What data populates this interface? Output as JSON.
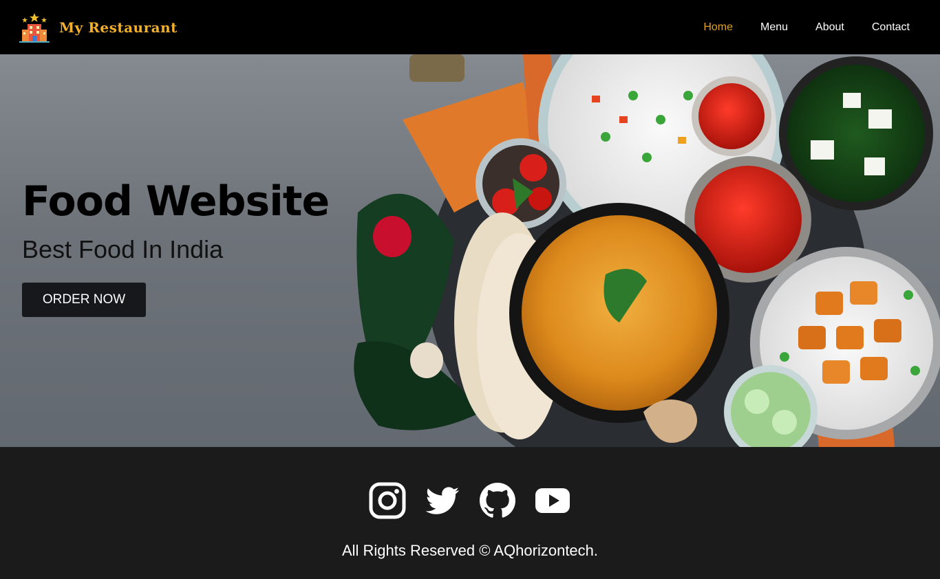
{
  "brand": {
    "name": "My Restaurant",
    "icon": "hotel-building-icon",
    "color": "#f2b02d"
  },
  "nav": {
    "accent": "#e0a020",
    "items": [
      {
        "label": "Home",
        "active": true
      },
      {
        "label": "Menu",
        "active": false
      },
      {
        "label": "About",
        "active": false
      },
      {
        "label": "Contact",
        "active": false
      }
    ]
  },
  "hero": {
    "title": "Food Website",
    "subtitle": "Best Food In India",
    "cta_label": "ORDER NOW"
  },
  "footer": {
    "social_icons": [
      "instagram-icon",
      "twitter-icon",
      "github-icon",
      "youtube-icon"
    ],
    "copyright": "All Rights Reserved © AQhorizontech."
  }
}
